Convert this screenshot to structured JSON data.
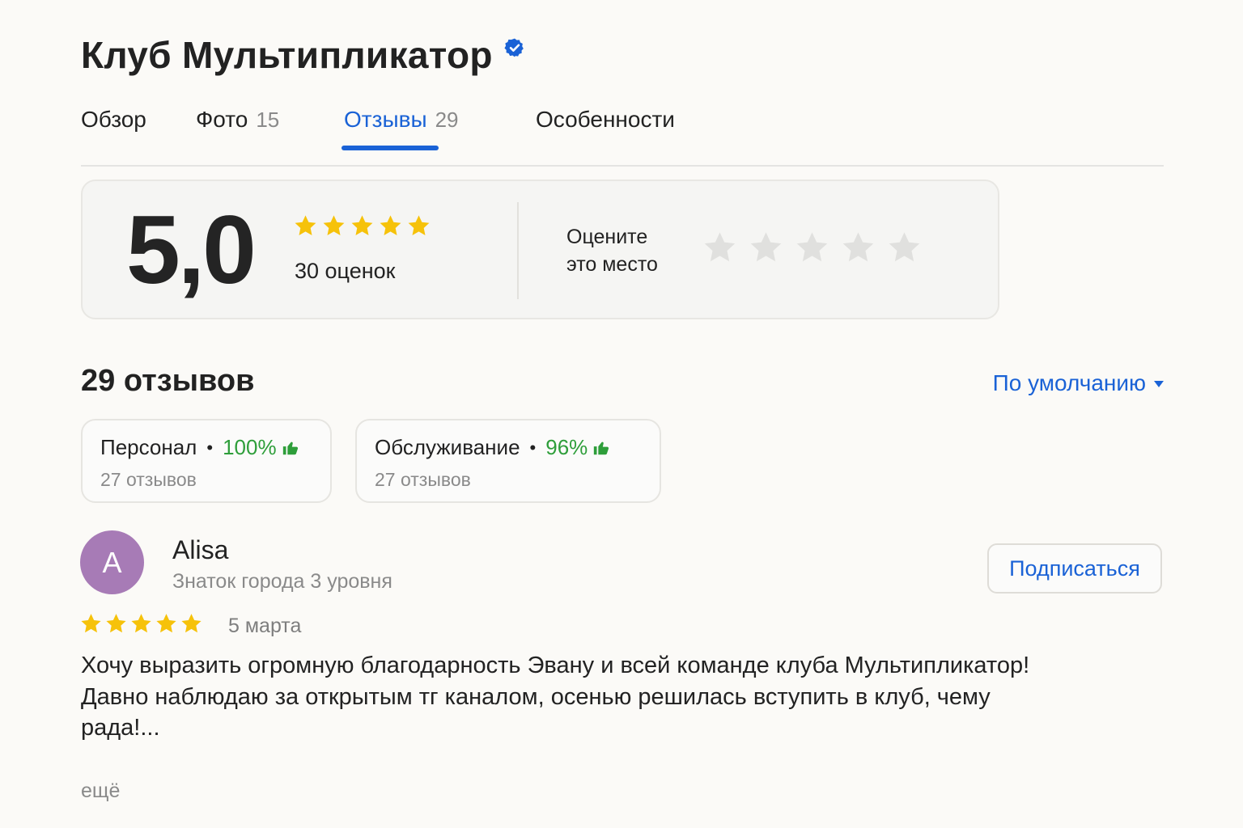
{
  "header": {
    "title": "Клуб Мультипликатор"
  },
  "tabs": [
    {
      "label": "Обзор",
      "count": ""
    },
    {
      "label": "Фото",
      "count": "15"
    },
    {
      "label": "Отзывы",
      "count": "29"
    },
    {
      "label": "Особенности",
      "count": ""
    }
  ],
  "active_tab": "Отзывы",
  "rating": {
    "score": "5,0",
    "stars_value": 5,
    "count_label": "30 оценок",
    "rate_prompt_line1": "Оцените",
    "rate_prompt_line2": "это место"
  },
  "reviews": {
    "heading": "29 отзывов",
    "sort_label": "По умолчанию"
  },
  "aspects": [
    {
      "name": "Персонал",
      "percent": "100%",
      "count_label": "27 отзывов"
    },
    {
      "name": "Обслуживание",
      "percent": "96%",
      "count_label": "27 отзывов"
    }
  ],
  "review": {
    "avatar_letter": "A",
    "author": "Alisa",
    "level": "Знаток города 3 уровня",
    "subscribe_label": "Подписаться",
    "stars_value": 5,
    "date": "5 марта",
    "text_line1": "Хочу выразить огромную благодарность Эвану и всей команде клуба Мультипликатор!",
    "text_line2": "Давно наблюдаю за открытым тг каналом, осенью решилась вступить в клуб, чему рада!...",
    "more_label": "ещё"
  },
  "colors": {
    "accent": "#1a62d6",
    "star": "#f6c20a",
    "star_empty": "#e0e0de",
    "positive": "#2e9e3a",
    "avatar": "#a77bb6"
  },
  "icons": {
    "verified": "verified-badge-icon",
    "star": "star-icon",
    "thumb": "thumbs-up-icon",
    "caret": "caret-down-icon"
  }
}
